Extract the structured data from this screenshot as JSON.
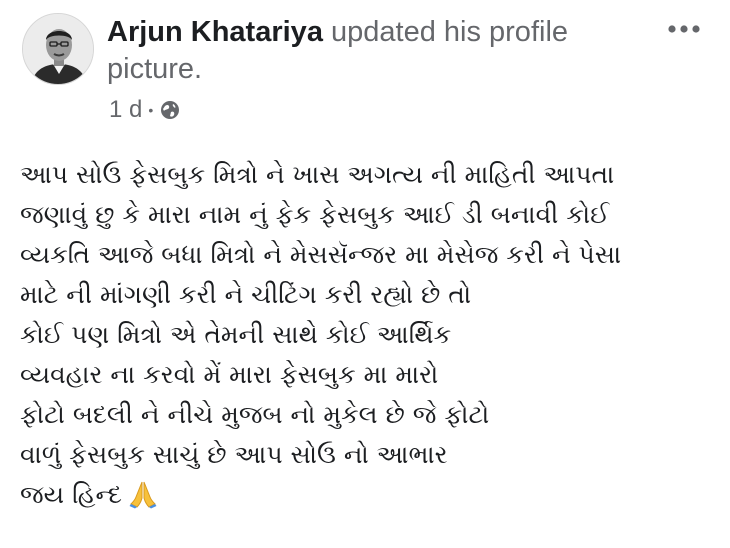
{
  "post": {
    "author": {
      "name": "Arjun Khatariya",
      "avatar_icon": "profile-photo"
    },
    "action_text": " updated his profile picture.",
    "timestamp": "1 d",
    "separator": "•",
    "privacy_icon": "globe-icon",
    "more_icon": "more-options-icon",
    "body_lines": [
      "આપ સોઉ ફેસબુક મિત્રો ને ખાસ અગત્ય ની માહિતી આપતા",
      "જણાવું છુ કે મારા નામ નું ફેક ફેસબુક આઈ ડી બનાવી કોઈ",
      "વ્યકતિ આજે બધા મિત્રો ને મેસસૅન્જર મા મેસેજ કરી ને પેસા",
      "માટે ની માંગણી કરી ને ચીટિંગ કરી રહ્યો છે તો",
      "કોઈ પણ મિત્રો એ તેમની સાથે કોઈ આર્થિક",
      "વ્યવહાર ના કરવો મેં મારા ફેસબુક મા મારો",
      "ફોટો બદલી ને નીચે મુજબ નો મુકેલ છે જે ફોટો",
      "વાળું ફેસબુક સાચું છે આપ સોઉ નો આભાર",
      "જય હિન્દ"
    ],
    "closing_emoji": "folded-hands-icon"
  },
  "colors": {
    "primary_text": "#1c1e21",
    "secondary_text": "#65676b",
    "background": "#ffffff"
  }
}
